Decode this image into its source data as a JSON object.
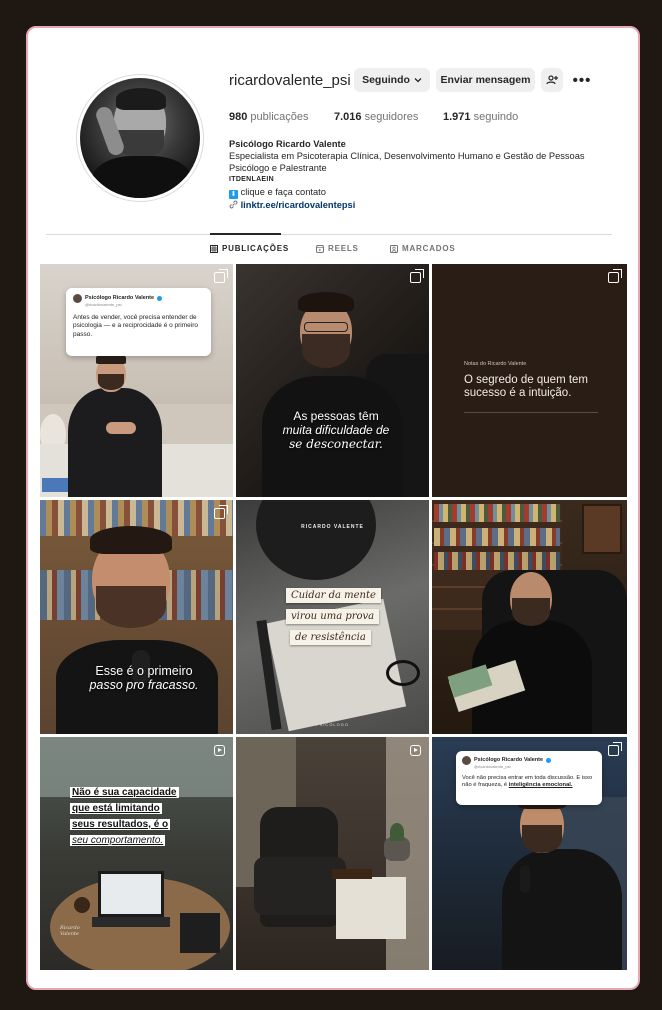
{
  "profile": {
    "username": "ricardovalente_psi",
    "following_button": "Seguindo",
    "message_button": "Enviar mensagem",
    "posts_count": "980",
    "posts_label": "publicações",
    "followers_count": "7.016",
    "followers_label": "seguidores",
    "following_count": "1.971",
    "following_label": "seguindo",
    "display_name": "Psicólogo Ricardo Valente",
    "bio_line1": "Especialista em Psicoterapia Clínica, Desenvolvimento Humano e Gestão de Pessoas",
    "bio_line2": "Psicólogo e Palestrante",
    "bio_line3": "ITDENLAEIN",
    "bio_cta": "clique e faça contato",
    "link": "linktr.ee/ricardovalentepsi"
  },
  "tabs": {
    "posts": "PUBLICAÇÕES",
    "reels": "REELS",
    "tagged": "MARCADOS"
  },
  "posts": {
    "p1": {
      "card_name": "Psicólogo Ricardo Valente",
      "card_handle": "@ricardovalente_psi",
      "card_text": "Antes de vender, você precisa entender de psicologia — e a reciprocidade é o primeiro passo."
    },
    "p2": {
      "caption_a": "As pessoas têm",
      "caption_b": "muita dificuldade de",
      "caption_c": "se desconectar."
    },
    "p3": {
      "header": "Notas do Ricardo Valente",
      "text_a": "O segredo de quem tem",
      "text_b": "sucesso é a intuição."
    },
    "p4": {
      "caption_a": "Esse é o primeiro",
      "caption_b": "passo pro fracasso."
    },
    "p5": {
      "brand": "RICARDO VALENTE",
      "line1": "Cuidar da mente",
      "line2": "virou uma prova",
      "line3": "de resistência",
      "footer": "PSICÓLOGO"
    },
    "p7": {
      "line1": "Não é sua capacidade",
      "line2": "que está limitando",
      "line3": "seus resultados, é o",
      "line4": "seu comportamento.",
      "signature": "Ricardo Valente"
    },
    "p9": {
      "card_name": "Psicólogo Ricardo Valente",
      "card_handle": "@ricardovalente_psi",
      "card_text_a": "Você não precisa entrar em toda discussão. E isso não é fraqueza, é ",
      "card_text_b": "inteligência emocional."
    }
  },
  "colors": {
    "background": "#1f1711",
    "frame_border": "#e7a7b3",
    "link": "#00376b",
    "verified": "#1d9bf0"
  }
}
